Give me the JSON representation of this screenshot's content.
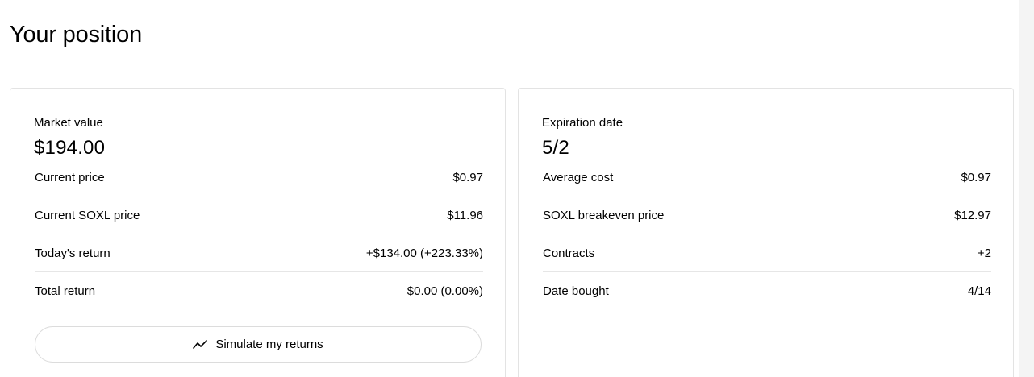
{
  "header": {
    "title": "Your position"
  },
  "left_card": {
    "hero_label": "Market value",
    "hero_value": "$194.00",
    "rows": [
      {
        "label": "Current price",
        "value": "$0.97"
      },
      {
        "label": "Current SOXL price",
        "value": "$11.96"
      },
      {
        "label": "Today's return",
        "value": "+$134.00 (+223.33%)"
      },
      {
        "label": "Total return",
        "value": "$0.00 (0.00%)"
      }
    ],
    "button_label": "Simulate my returns",
    "button_icon": "trend-line-icon"
  },
  "right_card": {
    "hero_label": "Expiration date",
    "hero_value": "5/2",
    "rows": [
      {
        "label": "Average cost",
        "value": "$0.97"
      },
      {
        "label": "SOXL breakeven price",
        "value": "$12.97"
      },
      {
        "label": "Contracts",
        "value": "+2"
      },
      {
        "label": "Date bought",
        "value": "4/14"
      }
    ]
  }
}
